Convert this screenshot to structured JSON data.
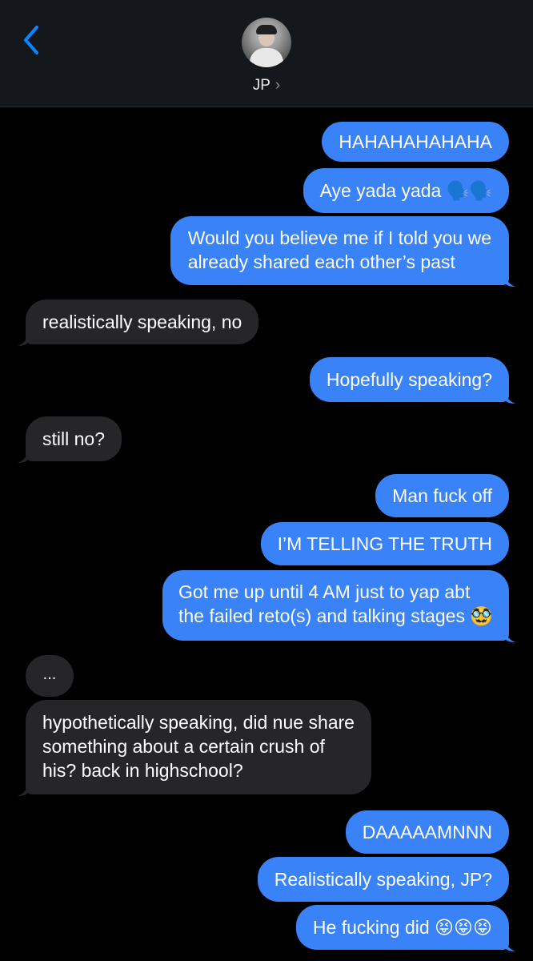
{
  "header": {
    "contact_name": "JP",
    "chevron": "›",
    "back_icon": "chevron-left-icon",
    "accent": "#0a84ff"
  },
  "messages": [
    {
      "from": "me",
      "text": "HAHAHAHAHAHA"
    },
    {
      "from": "me",
      "text": "Aye yada yada 🗣️🗣️"
    },
    {
      "from": "me",
      "lines": [
        "Would you believe me if I told you we",
        "already shared each other’s past"
      ]
    },
    {
      "from": "them",
      "text": "realistically speaking, no"
    },
    {
      "from": "me",
      "text": "Hopefully speaking?"
    },
    {
      "from": "them",
      "text": "still no?"
    },
    {
      "from": "me",
      "text": "Man fuck off"
    },
    {
      "from": "me",
      "text": "I’M TELLING THE TRUTH"
    },
    {
      "from": "me",
      "lines": [
        "Got me up until 4 AM just to yap abt",
        "the failed reto(s) and talking stages 🥸"
      ]
    },
    {
      "from": "them",
      "text": "..."
    },
    {
      "from": "them",
      "lines": [
        "hypothetically speaking, did nue share",
        "something about a certain crush of",
        "his? back in highschool?"
      ]
    },
    {
      "from": "me",
      "text": "DAAAAAMNNN"
    },
    {
      "from": "me",
      "text": "Realistically speaking, JP?"
    },
    {
      "from": "me",
      "text": "He fucking did 😝😝😝"
    }
  ],
  "colors": {
    "outgoing": "#3a82f7",
    "incoming": "#262628",
    "header_bg": "#14181d"
  }
}
